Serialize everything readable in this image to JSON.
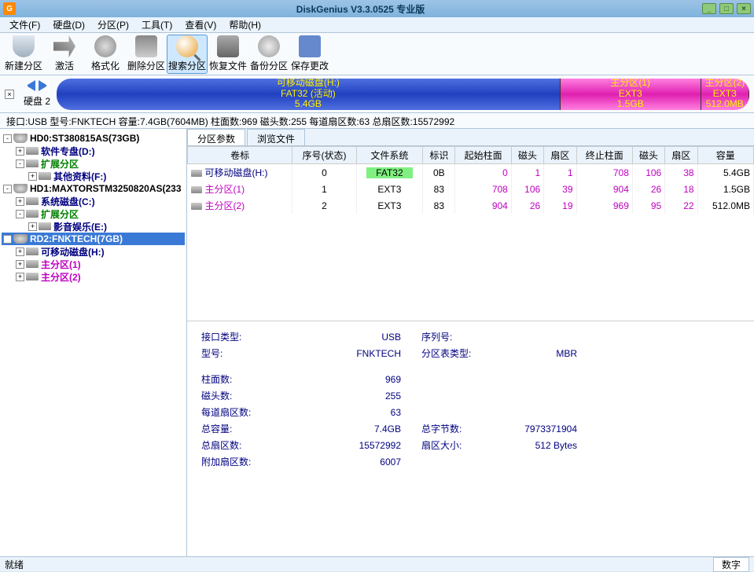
{
  "title": "DiskGenius V3.3.0525 专业版",
  "menu": [
    "文件(F)",
    "硬盘(D)",
    "分区(P)",
    "工具(T)",
    "查看(V)",
    "帮助(H)"
  ],
  "toolbar": [
    {
      "key": "new",
      "label": "新建分区"
    },
    {
      "key": "act",
      "label": "激活"
    },
    {
      "key": "fmt",
      "label": "格式化"
    },
    {
      "key": "del",
      "label": "删除分区"
    },
    {
      "key": "search",
      "label": "搜索分区",
      "selected": true
    },
    {
      "key": "recover",
      "label": "恢复文件"
    },
    {
      "key": "backup",
      "label": "备份分区"
    },
    {
      "key": "save",
      "label": "保存更改"
    }
  ],
  "disk_nav_label": "硬盘 2",
  "partitions_bar": [
    {
      "cls": "blue",
      "lines": [
        "可移动磁盘(H:)",
        "FAT32 (活动)",
        "5.4GB"
      ]
    },
    {
      "cls": "pink",
      "lines": [
        "主分区(1)",
        "EXT3",
        "1.5GB"
      ]
    },
    {
      "cls": "pink2",
      "lines": [
        "主分区(2)",
        "EXT3",
        "512.0MB"
      ]
    }
  ],
  "disk_info_line": "接口:USB  型号:FNKTECH  容量:7.4GB(7604MB)  柱面数:969  磁头数:255  每道扇区数:63  总扇区数:15572992",
  "tree": [
    {
      "indent": 0,
      "exp": "-",
      "icon": "disk",
      "label": "HD0:ST380815AS(73GB)",
      "cls": "c-black"
    },
    {
      "indent": 1,
      "exp": "+",
      "icon": "part",
      "label": "软件专盘(D:)",
      "cls": "c-navy"
    },
    {
      "indent": 1,
      "exp": "-",
      "icon": "part",
      "label": "扩展分区",
      "cls": "c-green"
    },
    {
      "indent": 2,
      "exp": "+",
      "icon": "part",
      "label": "其他资料(F:)",
      "cls": "c-navy"
    },
    {
      "indent": 0,
      "exp": "-",
      "icon": "disk",
      "label": "HD1:MAXTORSTM3250820AS(233",
      "cls": "c-black"
    },
    {
      "indent": 1,
      "exp": "+",
      "icon": "part",
      "label": "系统磁盘(C:)",
      "cls": "c-navy"
    },
    {
      "indent": 1,
      "exp": "-",
      "icon": "part",
      "label": "扩展分区",
      "cls": "c-green"
    },
    {
      "indent": 2,
      "exp": "+",
      "icon": "part",
      "label": "影音娱乐(E:)",
      "cls": "c-navy"
    },
    {
      "indent": 0,
      "exp": "-",
      "icon": "disk",
      "label": "RD2:FNKTECH(7GB)",
      "cls": "c-black",
      "selected": true
    },
    {
      "indent": 1,
      "exp": "+",
      "icon": "part",
      "label": "可移动磁盘(H:)",
      "cls": "c-navy"
    },
    {
      "indent": 1,
      "exp": "+",
      "icon": "part",
      "label": "主分区(1)",
      "cls": "c-mag"
    },
    {
      "indent": 1,
      "exp": "+",
      "icon": "part",
      "label": "主分区(2)",
      "cls": "c-mag"
    }
  ],
  "tabs": [
    "分区参数",
    "浏览文件"
  ],
  "active_tab": 0,
  "ptable": {
    "headers": [
      "卷标",
      "序号(状态)",
      "文件系统",
      "标识",
      "起始柱面",
      "磁头",
      "扇区",
      "终止柱面",
      "磁头",
      "扇区",
      "容量"
    ],
    "rows": [
      {
        "vol": "可移动磁盘(H:)",
        "cls": "c-navy",
        "seq": "0",
        "fs": "FAT32",
        "fs_hl": true,
        "id": "0B",
        "sc": "0",
        "sh": "1",
        "ss": "1",
        "ec": "708",
        "eh": "106",
        "es": "38",
        "cap": "5.4GB",
        "cfs": "c-mag"
      },
      {
        "vol": "主分区(1)",
        "cls": "c-mag",
        "seq": "1",
        "fs": "EXT3",
        "id": "83",
        "sc": "708",
        "sh": "106",
        "ss": "39",
        "ec": "904",
        "eh": "26",
        "es": "18",
        "cap": "1.5GB",
        "cfs": "c-mag"
      },
      {
        "vol": "主分区(2)",
        "cls": "c-mag",
        "seq": "2",
        "fs": "EXT3",
        "id": "83",
        "sc": "904",
        "sh": "26",
        "ss": "19",
        "ec": "969",
        "eh": "95",
        "es": "22",
        "cap": "512.0MB",
        "cfs": "c-mag"
      }
    ]
  },
  "details": {
    "rows1": [
      [
        "接口类型:",
        "USB",
        "序列号:",
        ""
      ],
      [
        "型号:",
        "FNKTECH",
        "分区表类型:",
        "MBR"
      ]
    ],
    "rows2": [
      [
        "柱面数:",
        "969",
        "",
        ""
      ],
      [
        "磁头数:",
        "255",
        "",
        ""
      ],
      [
        "每道扇区数:",
        "63",
        "",
        ""
      ],
      [
        "总容量:",
        "7.4GB",
        "总字节数:",
        "7973371904"
      ],
      [
        "总扇区数:",
        "15572992",
        "扇区大小:",
        "512 Bytes"
      ],
      [
        "附加扇区数:",
        "6007",
        "",
        ""
      ]
    ]
  },
  "status": {
    "left": "就绪",
    "right": "数字"
  }
}
